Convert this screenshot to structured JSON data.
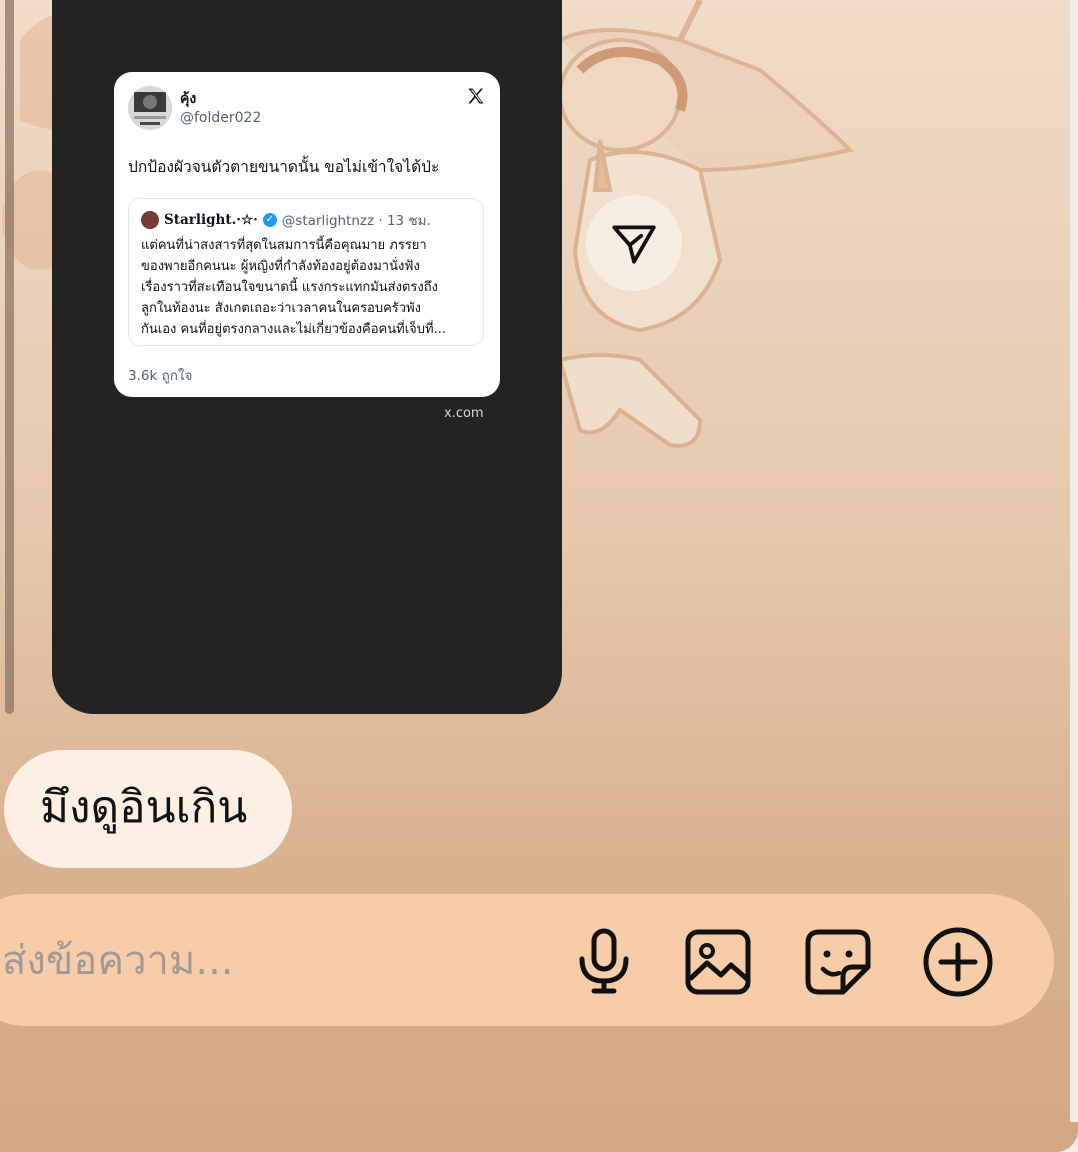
{
  "tweet": {
    "author_name": "คุ้ง",
    "author_handle": "@folder022",
    "text": "ปกป้องผัวจนตัวตายขนาดนั้น ขอไม่เข้าใจได้ป่ะ",
    "quote": {
      "name": "Starlight.·☆·",
      "handle_time": "@starlightnzz · 13 ชม.",
      "body": "แต่คนที่น่าสงสารที่สุดในสมการนี้คือคุณมาย ภรรยา\nของพายอีกคนนะ ผู้หญิงที่กำลังท้องอยู่ต้องมานั่งฟัง\nเรื่องราวที่สะเทือนใจขนาดนี้ แรงกระแทกมันส่งตรงถึง\nลูกในท้องนะ สังเกตเถอะว่าเวลาคนในครอบครัวพัง\nกันเอง คนที่อยู่ตรงกลางและไม่เกี่ยวข้องคือคนที่เจ็บที่..."
    },
    "likes": "3.6k ถูกใจ"
  },
  "link_domain": "x.com",
  "messages": {
    "incoming_text": "มึงดูอินเกิน"
  },
  "composer": {
    "placeholder": "ส่งข้อความ...",
    "value": ""
  },
  "icons": {
    "share": "send-paper-plane-icon",
    "mic": "microphone-icon",
    "gallery": "image-icon",
    "sticker": "sticker-icon",
    "more": "plus-circle-icon",
    "x_logo": "x-logo-icon"
  },
  "colors": {
    "bubble": "#fbf0e3",
    "composer": "#f6cda8",
    "card": "#232323",
    "verified": "#1d9bf0"
  }
}
